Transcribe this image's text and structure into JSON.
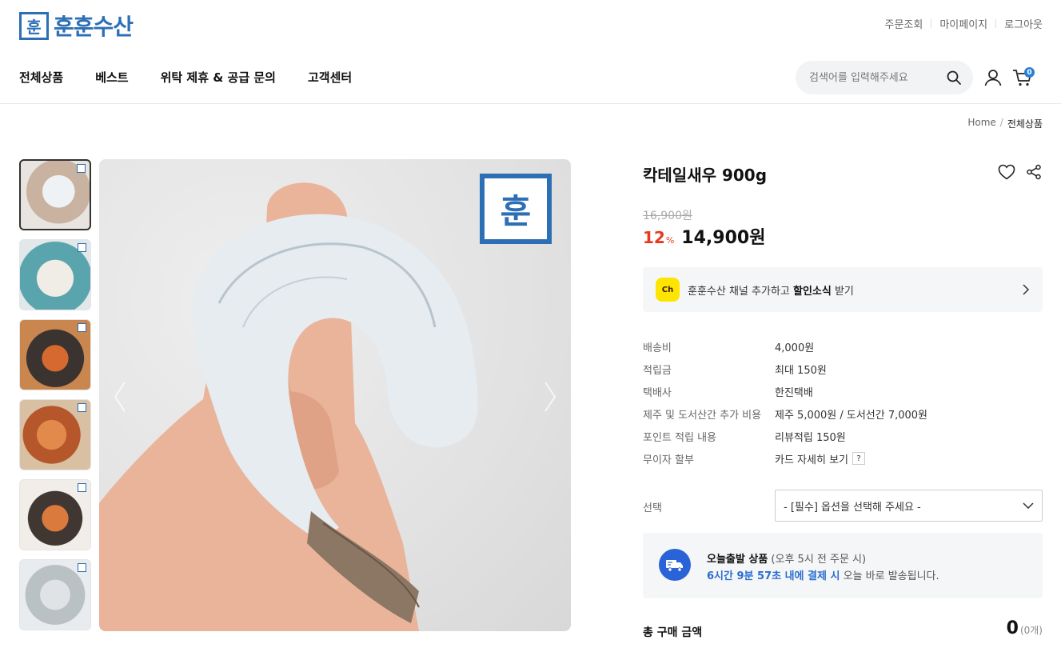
{
  "brand": {
    "name": "훈훈수산",
    "logo_glyph": "훈",
    "color": "#2d6fb5"
  },
  "util_nav": [
    "주문조회",
    "마이페이지",
    "로그아웃"
  ],
  "main_nav": [
    "전체상품",
    "베스트",
    "위탁 제휴 & 공급 문의",
    "고객센터"
  ],
  "search": {
    "placeholder": "검색어를 입력해주세요"
  },
  "cart": {
    "count": "0"
  },
  "breadcrumb": {
    "home": "Home",
    "sep": "/",
    "current": "전체상품"
  },
  "product": {
    "title": "칵테일새우 900g",
    "original_price": "16,900원",
    "discount": "12",
    "discount_unit": "%",
    "sale_price": "14,900원"
  },
  "kakao_banner": {
    "icon_label": "Ch",
    "pre": "훈훈수산 채널 추가하고 ",
    "bold": "할인소식",
    "post": " 받기"
  },
  "info": [
    {
      "label": "배송비",
      "value": "4,000원"
    },
    {
      "label": "적립금",
      "value": "최대 150원"
    },
    {
      "label": "택배사",
      "value": "한진택배"
    },
    {
      "label": "제주 및 도서산간 추가 비용",
      "value": "제주 5,000원 / 도서선간 7,000원"
    },
    {
      "label": "포인트 적립 내용",
      "value": "리뷰적립 150원"
    },
    {
      "label": "무이자 할부",
      "value": "카드 자세히 보기",
      "help": "?"
    }
  ],
  "option": {
    "label": "선택",
    "selected": "- [필수] 옵션을 선택해 주세요 -"
  },
  "delivery": {
    "title": "오늘출발 상품",
    "title_note": " (오후 5시 전 주문 시)",
    "countdown": "6시간 9분 57초 내에 결제 시",
    "suffix": " 오늘 바로 발송됩니다."
  },
  "total": {
    "label": "총 구매 금액",
    "amount": "0",
    "count": "(0개)"
  }
}
